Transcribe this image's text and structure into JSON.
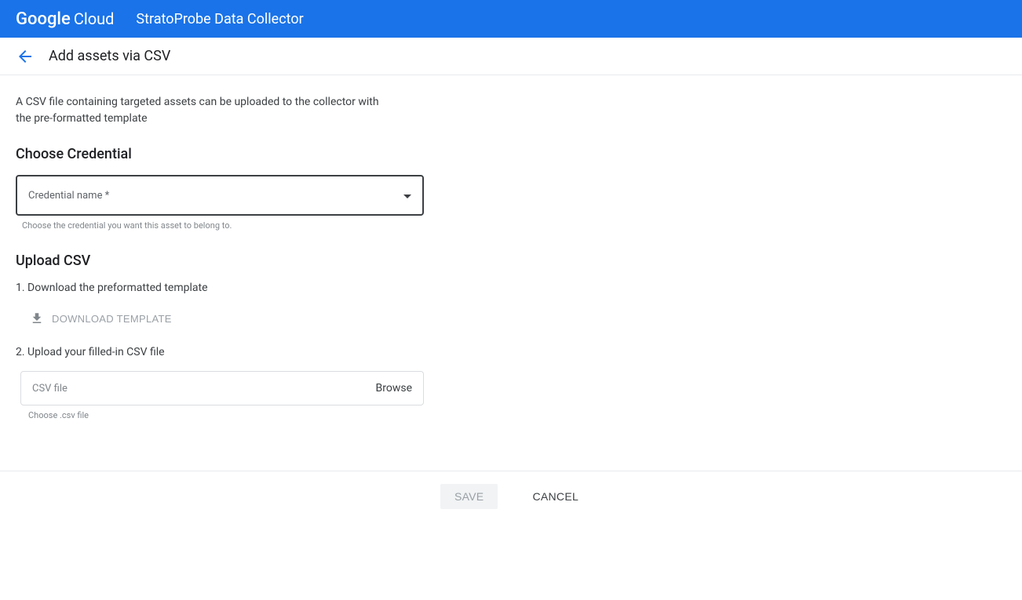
{
  "header": {
    "logo_primary": "Google",
    "logo_secondary": "Cloud",
    "product": "StratoProbe Data Collector"
  },
  "page": {
    "title": "Add assets via CSV",
    "intro": "A CSV file containing targeted assets can be uploaded to the collector with the pre-formatted template"
  },
  "credential": {
    "heading": "Choose Credential",
    "label": "Credential name *",
    "helper": "Choose the credential you want this asset to belong to."
  },
  "upload": {
    "heading": "Upload CSV",
    "step1": "1. Download the preformatted template",
    "download_label": "DOWNLOAD TEMPLATE",
    "step2": "2. Upload your filled-in CSV file",
    "file_label": "CSV file",
    "browse": "Browse",
    "helper": "Choose .csv file"
  },
  "footer": {
    "save": "SAVE",
    "cancel": "CANCEL"
  }
}
